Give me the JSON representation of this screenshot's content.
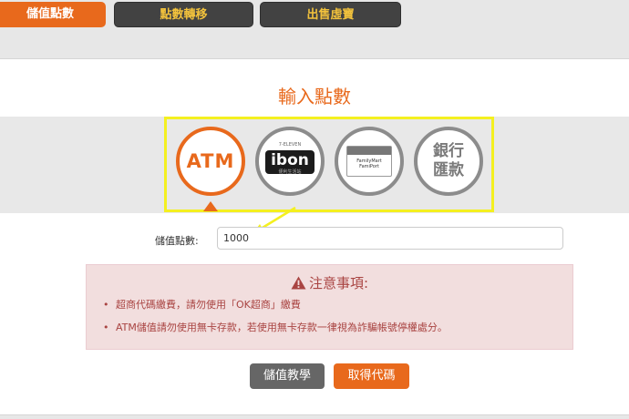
{
  "tabs": [
    {
      "label": "儲值點數",
      "active": true
    },
    {
      "label": "點數轉移",
      "active": false
    },
    {
      "label": "出售虛寶",
      "active": false
    }
  ],
  "section_title": "輸入點數",
  "payment_methods": [
    {
      "name": "ATM",
      "label": "ATM",
      "selected": true,
      "icon": "atm-text-icon"
    },
    {
      "name": "ibon",
      "label": "ibon",
      "sub": "便利生活站",
      "top": "7-ELEVEN",
      "selected": false,
      "icon": "ibon-logo-icon"
    },
    {
      "name": "FamiPort",
      "label": "FamiPort",
      "top": "FamilyMart",
      "selected": false,
      "icon": "famiport-kiosk-icon"
    },
    {
      "name": "bank",
      "label_line1": "銀行",
      "label_line2": "匯款",
      "selected": false,
      "icon": "bank-transfer-icon"
    }
  ],
  "form": {
    "points_label": "儲值點數:",
    "points_value": "1000"
  },
  "notice": {
    "title": "注意事項:",
    "items": [
      "超商代碼繳費，請勿使用「OK超商」繳費",
      "ATM儲值請勿使用無卡存款，若使用無卡存款一律視為詐騙帳號停權處分。"
    ]
  },
  "buttons": {
    "tutorial": "儲值教學",
    "get_code": "取得代碼"
  },
  "colors": {
    "accent": "#e8691c",
    "tab_dark": "#424242",
    "tab_text": "#f2c23c",
    "highlight": "#f4f020",
    "notice_bg": "#f2dede",
    "notice_text": "#a94442"
  }
}
